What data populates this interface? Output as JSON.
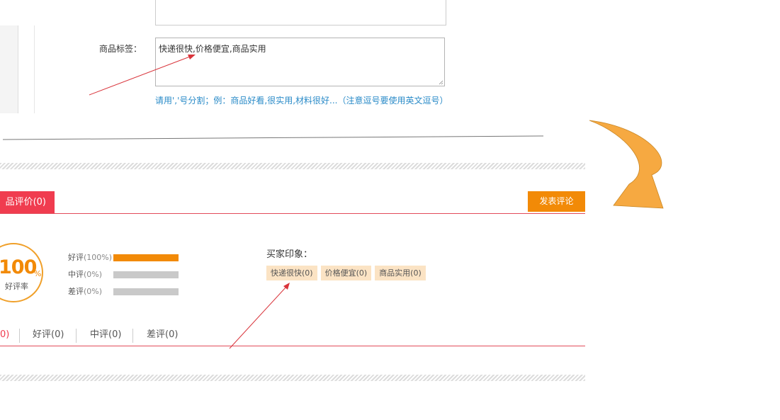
{
  "form": {
    "tag_label": "商品标签：",
    "tag_value": "快递很快,价格便宜,商品实用",
    "tag_hint": "请用','号分割；例：商品好看,很实用,材料很好...（注意逗号要使用英文逗号）"
  },
  "reviews": {
    "tab_label": "品评价(0)",
    "post_button": "发表评论",
    "rating": {
      "value": "100",
      "unit": "%",
      "label": "好评率"
    },
    "bars": [
      {
        "name": "好评",
        "pct": "(100%)",
        "fraction": 1.0
      },
      {
        "name": "中评",
        "pct": "(0%)",
        "fraction": 0.0
      },
      {
        "name": "差评",
        "pct": "(0%)",
        "fraction": 0.0
      }
    ],
    "impression_title": "买家印象：",
    "impression_tags": [
      "快递很快(0)",
      "价格便宜(0)",
      "商品实用(0)"
    ],
    "filters": [
      "0)",
      "好评(0)",
      "中评(0)",
      "差评(0)"
    ]
  },
  "colors": {
    "accent_red": "#f03c4f",
    "accent_orange": "#f28a07",
    "hint_blue": "#2a8bc8",
    "tag_bg": "#fbe3c4",
    "annotation_arrow": "#f6a941"
  }
}
